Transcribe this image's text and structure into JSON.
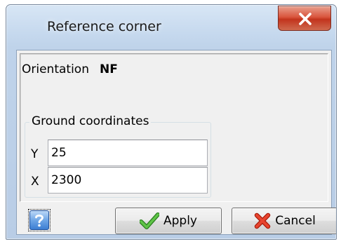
{
  "window": {
    "title": "Reference corner"
  },
  "orientation": {
    "label": "Orientation",
    "value": "NF"
  },
  "ground_coordinates": {
    "title": "Ground coordinates",
    "y": {
      "label": "Y",
      "value": "25"
    },
    "x": {
      "label": "X",
      "value": "2300"
    }
  },
  "buttons": {
    "apply": "Apply",
    "cancel": "Cancel"
  },
  "icons": {
    "close": "close-x-icon",
    "help": "question-mark-icon",
    "apply": "green-checkmark-icon",
    "cancel": "red-x-icon"
  },
  "colors": {
    "close_button": "#d9553d",
    "apply_check": "#3ea22e",
    "cancel_x": "#d9321c",
    "help": "#3c7ed3"
  }
}
